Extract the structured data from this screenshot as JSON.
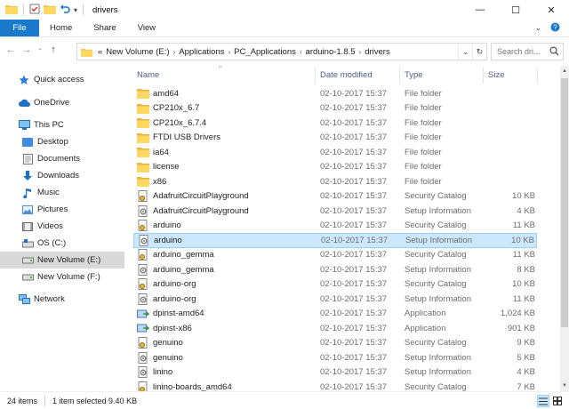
{
  "window": {
    "title": "drivers",
    "controls": {
      "minimize": "—",
      "maximize": "☐",
      "close": "✕"
    }
  },
  "ribbon": {
    "tabs": [
      "File",
      "Home",
      "Share",
      "View"
    ],
    "accent": "#1979ca"
  },
  "address": {
    "prefix": "«",
    "crumbs": [
      "New Volume (E:)",
      "Applications",
      "PC_Applications",
      "arduino-1.8.5",
      "drivers"
    ],
    "search_placeholder": "Search dri..."
  },
  "nav": {
    "items": [
      {
        "label": "Quick access",
        "icon": "star-icon",
        "level": 0
      },
      {
        "label": "OneDrive",
        "icon": "cloud-icon",
        "level": 0
      },
      {
        "label": "This PC",
        "icon": "monitor-icon",
        "level": 0
      },
      {
        "label": "Desktop",
        "icon": "desktop-folder-icon",
        "level": 1
      },
      {
        "label": "Documents",
        "icon": "documents-folder-icon",
        "level": 1
      },
      {
        "label": "Downloads",
        "icon": "download-arrow-icon",
        "level": 1
      },
      {
        "label": "Music",
        "icon": "music-note-icon",
        "level": 1
      },
      {
        "label": "Pictures",
        "icon": "pictures-folder-icon",
        "level": 1
      },
      {
        "label": "Videos",
        "icon": "videos-folder-icon",
        "level": 1
      },
      {
        "label": "OS (C:)",
        "icon": "windows-drive-icon",
        "level": 1
      },
      {
        "label": "New Volume (E:)",
        "icon": "drive-icon",
        "level": 1,
        "selected": true
      },
      {
        "label": "New Volume (F:)",
        "icon": "drive-icon",
        "level": 1
      },
      {
        "label": "Network",
        "icon": "network-icon",
        "level": 0
      }
    ]
  },
  "columns": {
    "name": "Name",
    "date": "Date modified",
    "type": "Type",
    "size": "Size"
  },
  "files": [
    {
      "name": "amd64",
      "date": "02-10-2017 15:37",
      "type": "File folder",
      "size": "",
      "icon": "folder-icon"
    },
    {
      "name": "CP210x_6.7",
      "date": "02-10-2017 15:37",
      "type": "File folder",
      "size": "",
      "icon": "folder-icon"
    },
    {
      "name": "CP210x_6.7.4",
      "date": "02-10-2017 15:37",
      "type": "File folder",
      "size": "",
      "icon": "folder-icon"
    },
    {
      "name": "FTDI USB Drivers",
      "date": "02-10-2017 15:37",
      "type": "File folder",
      "size": "",
      "icon": "folder-icon"
    },
    {
      "name": "ia64",
      "date": "02-10-2017 15:37",
      "type": "File folder",
      "size": "",
      "icon": "folder-icon"
    },
    {
      "name": "license",
      "date": "02-10-2017 15:37",
      "type": "File folder",
      "size": "",
      "icon": "folder-icon"
    },
    {
      "name": "x86",
      "date": "02-10-2017 15:37",
      "type": "File folder",
      "size": "",
      "icon": "folder-icon"
    },
    {
      "name": "AdafruitCircuitPlayground",
      "date": "02-10-2017 15:37",
      "type": "Security Catalog",
      "size": "10 KB",
      "icon": "security-catalog-icon"
    },
    {
      "name": "AdafruitCircuitPlayground",
      "date": "02-10-2017 15:37",
      "type": "Setup Information",
      "size": "4 KB",
      "icon": "setup-information-icon"
    },
    {
      "name": "arduino",
      "date": "02-10-2017 15:37",
      "type": "Security Catalog",
      "size": "11 KB",
      "icon": "security-catalog-icon"
    },
    {
      "name": "arduino",
      "date": "02-10-2017 15:37",
      "type": "Setup Information",
      "size": "10 KB",
      "icon": "setup-information-icon",
      "selected": true
    },
    {
      "name": "arduino_gemma",
      "date": "02-10-2017 15:37",
      "type": "Security Catalog",
      "size": "11 KB",
      "icon": "security-catalog-icon"
    },
    {
      "name": "arduino_gemma",
      "date": "02-10-2017 15:37",
      "type": "Setup Information",
      "size": "8 KB",
      "icon": "setup-information-icon"
    },
    {
      "name": "arduino-org",
      "date": "02-10-2017 15:37",
      "type": "Security Catalog",
      "size": "10 KB",
      "icon": "security-catalog-icon"
    },
    {
      "name": "arduino-org",
      "date": "02-10-2017 15:37",
      "type": "Setup Information",
      "size": "11 KB",
      "icon": "setup-information-icon"
    },
    {
      "name": "dpinst-amd64",
      "date": "02-10-2017 15:37",
      "type": "Application",
      "size": "1,024 KB",
      "icon": "application-icon"
    },
    {
      "name": "dpinst-x86",
      "date": "02-10-2017 15:37",
      "type": "Application",
      "size": "901 KB",
      "icon": "application-icon"
    },
    {
      "name": "genuino",
      "date": "02-10-2017 15:37",
      "type": "Security Catalog",
      "size": "9 KB",
      "icon": "security-catalog-icon"
    },
    {
      "name": "genuino",
      "date": "02-10-2017 15:37",
      "type": "Setup Information",
      "size": "5 KB",
      "icon": "setup-information-icon"
    },
    {
      "name": "linino",
      "date": "02-10-2017 15:37",
      "type": "Setup Information",
      "size": "4 KB",
      "icon": "setup-information-icon"
    },
    {
      "name": "linino-boards_amd64",
      "date": "02-10-2017 15:37",
      "type": "Security Catalog",
      "size": "7 KB",
      "icon": "security-catalog-icon"
    }
  ],
  "status": {
    "count": "24 items",
    "selection": "1 item selected  9.40 KB"
  },
  "colors": {
    "selection_bg": "#cce8ff",
    "selection_border": "#99d1ff",
    "folder": "#f4c550",
    "header_text": "#4d6082"
  }
}
